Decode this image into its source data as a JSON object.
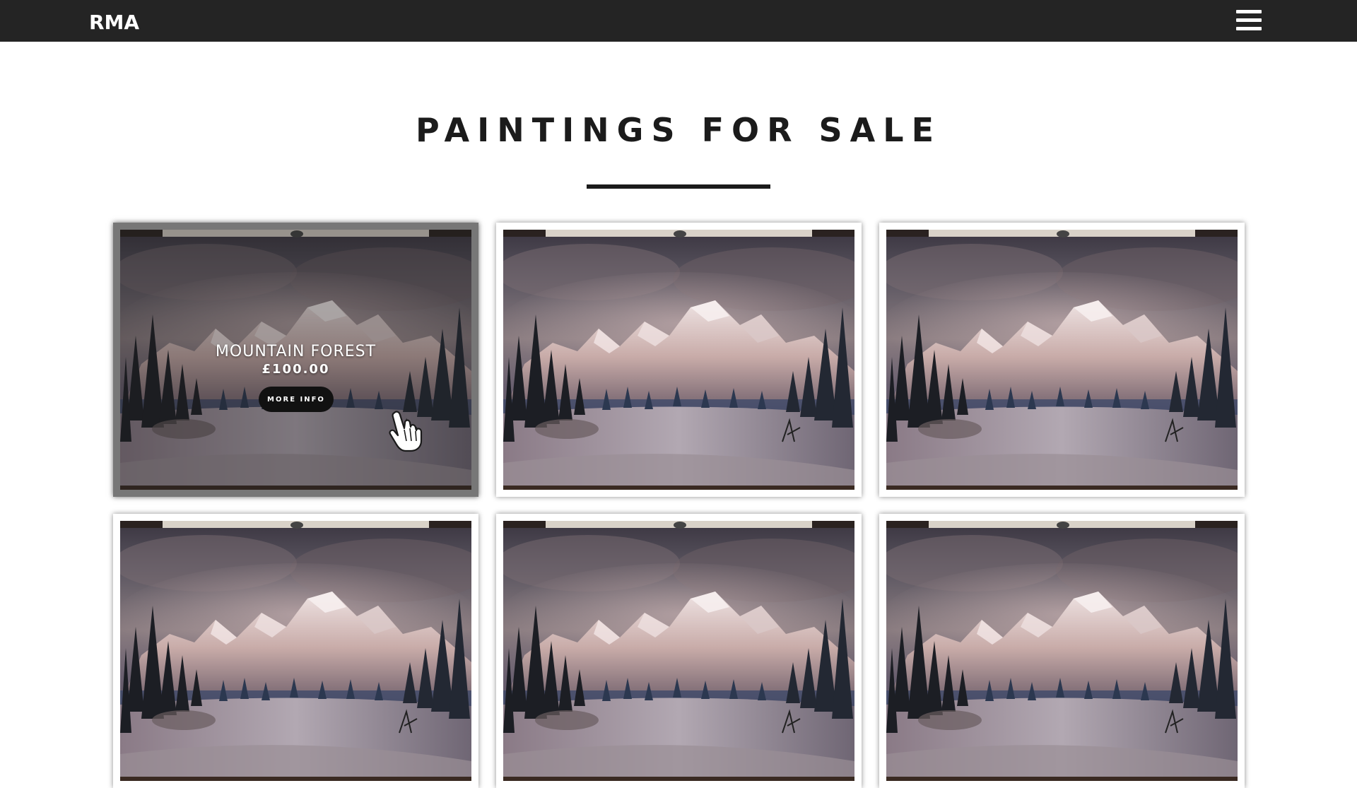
{
  "nav": {
    "brand": "RMA",
    "menu_icon": "hamburger-menu-icon"
  },
  "main": {
    "title": "PAINTINGS FOR SALE"
  },
  "gallery": {
    "items": [
      {
        "name": "MOUNTAIN FOREST",
        "price": "£100.00",
        "button_label": "MORE INFO",
        "hovered": true
      },
      {
        "hovered": false
      },
      {
        "hovered": false
      },
      {
        "hovered": false
      },
      {
        "hovered": false
      },
      {
        "hovered": false
      }
    ]
  },
  "colors": {
    "navbar_bg": "#242424",
    "title_text": "#1b1b1b",
    "button_bg": "#111111"
  },
  "icons": {
    "cursor": "hand-pointer-icon"
  }
}
